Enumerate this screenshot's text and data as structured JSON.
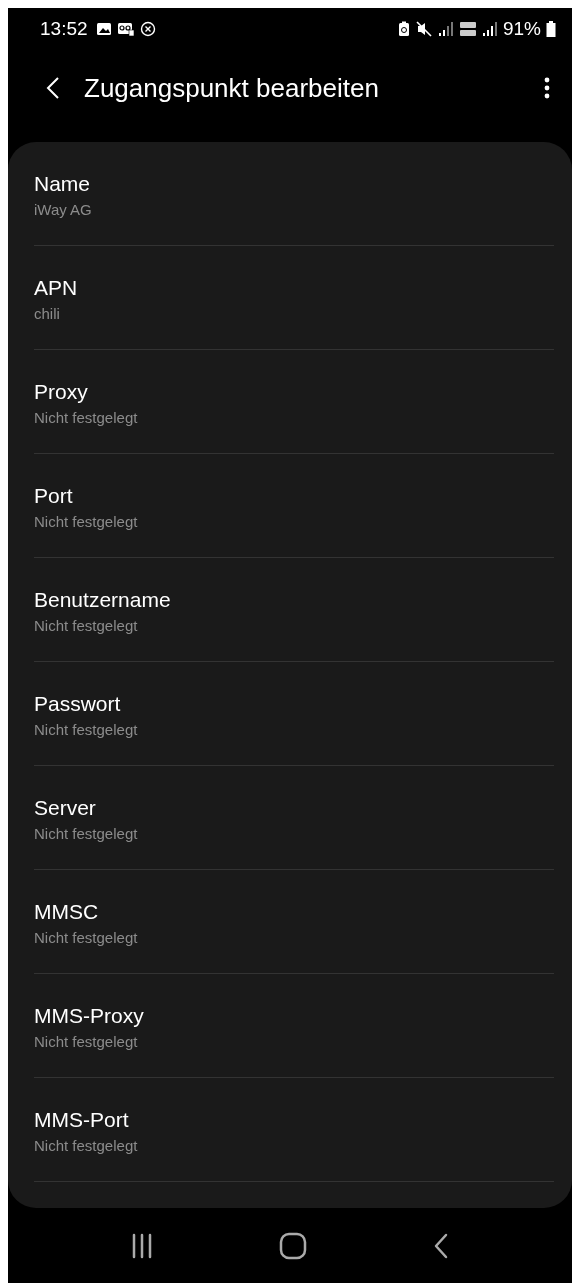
{
  "status_bar": {
    "time": "13:52",
    "battery_percent": "91%"
  },
  "header": {
    "title": "Zugangspunkt bearbeiten"
  },
  "fields": [
    {
      "label": "Name",
      "value": "iWay AG"
    },
    {
      "label": "APN",
      "value": "chili"
    },
    {
      "label": "Proxy",
      "value": "Nicht festgelegt"
    },
    {
      "label": "Port",
      "value": "Nicht festgelegt"
    },
    {
      "label": "Benutzername",
      "value": "Nicht festgelegt"
    },
    {
      "label": "Passwort",
      "value": "Nicht festgelegt"
    },
    {
      "label": "Server",
      "value": "Nicht festgelegt"
    },
    {
      "label": "MMSC",
      "value": "Nicht festgelegt"
    },
    {
      "label": "MMS-Proxy",
      "value": "Nicht festgelegt"
    },
    {
      "label": "MMS-Port",
      "value": "Nicht festgelegt"
    }
  ]
}
